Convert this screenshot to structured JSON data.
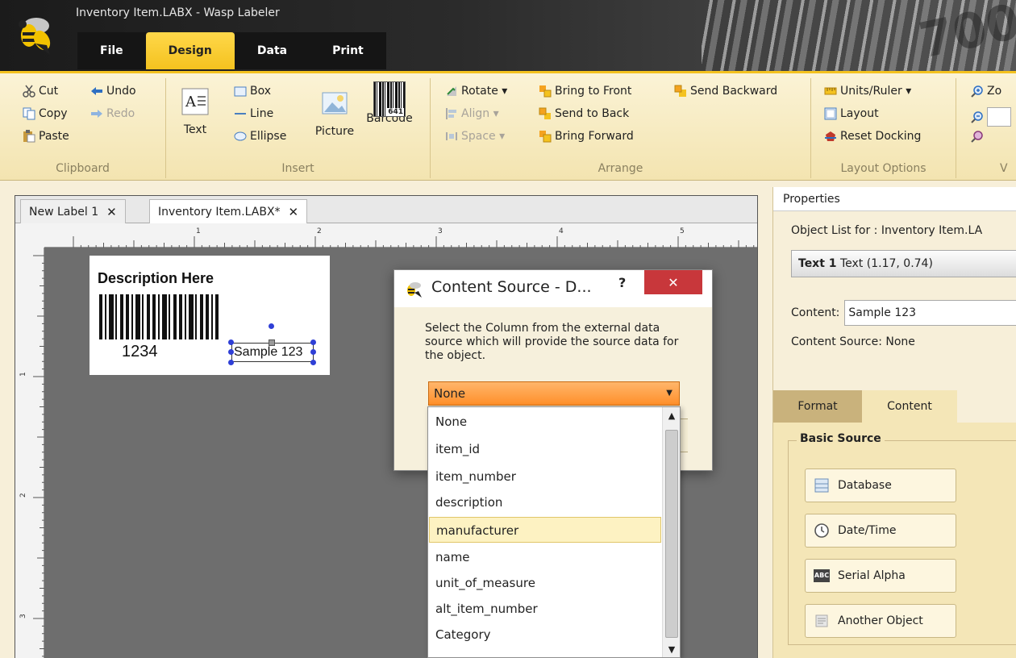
{
  "window": {
    "title": "Inventory Item.LABX - Wasp Labeler",
    "barcode_art_text": "700"
  },
  "menu": {
    "tabs": [
      {
        "label": "File"
      },
      {
        "label": "Design"
      },
      {
        "label": "Data"
      },
      {
        "label": "Print"
      }
    ],
    "active": "Design"
  },
  "ribbon": {
    "clipboard": {
      "label": "Clipboard",
      "cut": "Cut",
      "copy": "Copy",
      "paste": "Paste",
      "undo": "Undo",
      "redo": "Redo"
    },
    "insert": {
      "label": "Insert",
      "text": "Text",
      "box": "Box",
      "line": "Line",
      "ellipse": "Ellipse",
      "picture": "Picture",
      "barcode": "Barcode",
      "barcode_icon_digits": "641"
    },
    "arrange": {
      "label": "Arrange",
      "rotate": "Rotate ▾",
      "align": "Align ▾",
      "space": "Space ▾",
      "bring_to_front": "Bring to Front",
      "send_to_back": "Send to Back",
      "bring_forward": "Bring Forward",
      "send_backward": "Send Backward"
    },
    "layout_options": {
      "label": "Layout Options",
      "units_ruler": "Units/Ruler ▾",
      "layout": "Layout",
      "reset_docking": "Reset Docking"
    },
    "view": {
      "zoom_partial": "Zo",
      "label_partial": "V"
    }
  },
  "doc_tabs": [
    {
      "label": "New Label 1",
      "close": "✕"
    },
    {
      "label": "Inventory Item.LABX*",
      "close": "✕"
    }
  ],
  "ruler": {
    "h_marks": [
      "1",
      "2",
      "3",
      "4",
      "5"
    ],
    "v_marks": [
      "1",
      "2",
      "3"
    ]
  },
  "label": {
    "description": "Description Here",
    "barcode_value": "1234",
    "selected_text": "Sample 123"
  },
  "dialog": {
    "title": "Content Source - D...",
    "help": "?",
    "close": "✕",
    "instructions": "Select the Column from the external data source which will provide the source data for the object.",
    "selected": "None",
    "options": [
      "None",
      "item_id",
      "item_number",
      "description",
      "manufacturer",
      "name",
      "unit_of_measure",
      "alt_item_number",
      "Category"
    ],
    "hovered": "manufacturer"
  },
  "properties": {
    "header": "Properties",
    "object_list_label": "Object List for :  Inventory Item.LA",
    "object_selected_bold": "Text 1",
    "object_selected_rest": " Text (1.17, 0.74)",
    "content_label": "Content:",
    "content_value": "Sample 123",
    "content_source": "Content Source: None",
    "tabs": {
      "format": "Format",
      "content": "Content"
    },
    "basic_source_title": "Basic Source",
    "sources": [
      "Database",
      "Date/Time",
      "Serial Alpha",
      "Another Object"
    ]
  },
  "colors": {
    "accent": "#f4c21f",
    "combo_orange": "#ff8f2a",
    "close_red": "#c8373b",
    "handle_blue": "#2f3fd6"
  }
}
